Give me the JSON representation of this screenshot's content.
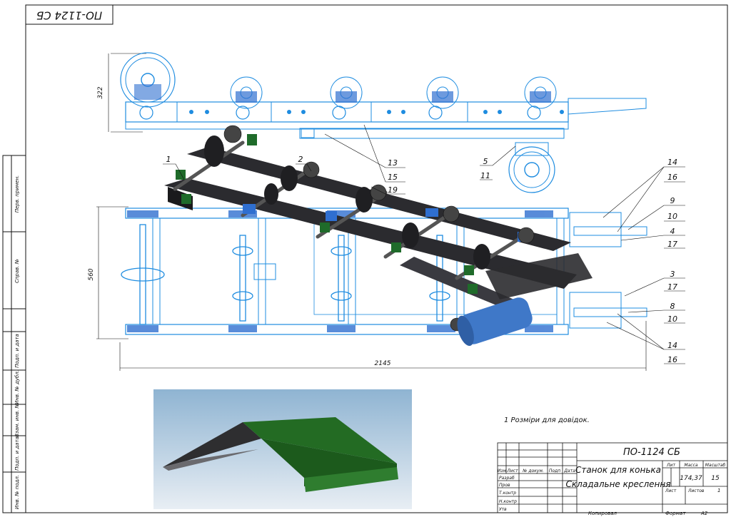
{
  "drawing_code": "ПО-1124 СБ",
  "dimensions": {
    "top_height": "322",
    "side_height": "560",
    "overall_length": "2145"
  },
  "callouts": [
    "1",
    "2",
    "13",
    "15",
    "19",
    "5",
    "11",
    "14",
    "16",
    "9",
    "10",
    "4",
    "17",
    "3",
    "17",
    "8",
    "10",
    "14",
    "16"
  ],
  "note": "1 Розміри для довідок.",
  "left_strip": [
    "Перв. примен.",
    "Справ. №",
    "Подп. и дата",
    "Инв. № дубл.",
    "Взам. инв. №",
    "Подп. и дата",
    "Инв. № подл."
  ],
  "title_block": {
    "code": "ПО-1124 СБ",
    "title_line1": "Станок для конька",
    "title_line2": "Складальне креслення",
    "col_izm": "Изм",
    "col_list": "Лист",
    "col_doc": "№ докум.",
    "col_podp": "Подп",
    "col_date": "Дата",
    "row_razrab": "Разраб",
    "row_prov": "Пров",
    "row_tkontr": "Т.контр",
    "row_nkontr": "Н.контр",
    "row_utv": "Утв",
    "lit_label": "Лит",
    "mass_label": "Масса",
    "scale_label": "Масштаб",
    "mass_value": "174,37",
    "scale_value": "15",
    "sheet_label": "Лист",
    "sheets_label": "Листов",
    "sheets_value": "1",
    "copied": "Копировал",
    "format_label": "Формат",
    "format_value": "A2"
  },
  "colors": {
    "frame_blue": "#1e8ce0",
    "dark_steel": "#2b2b2f",
    "green_part": "#1f6b2a",
    "bearing_blue": "#2f6fd0"
  }
}
